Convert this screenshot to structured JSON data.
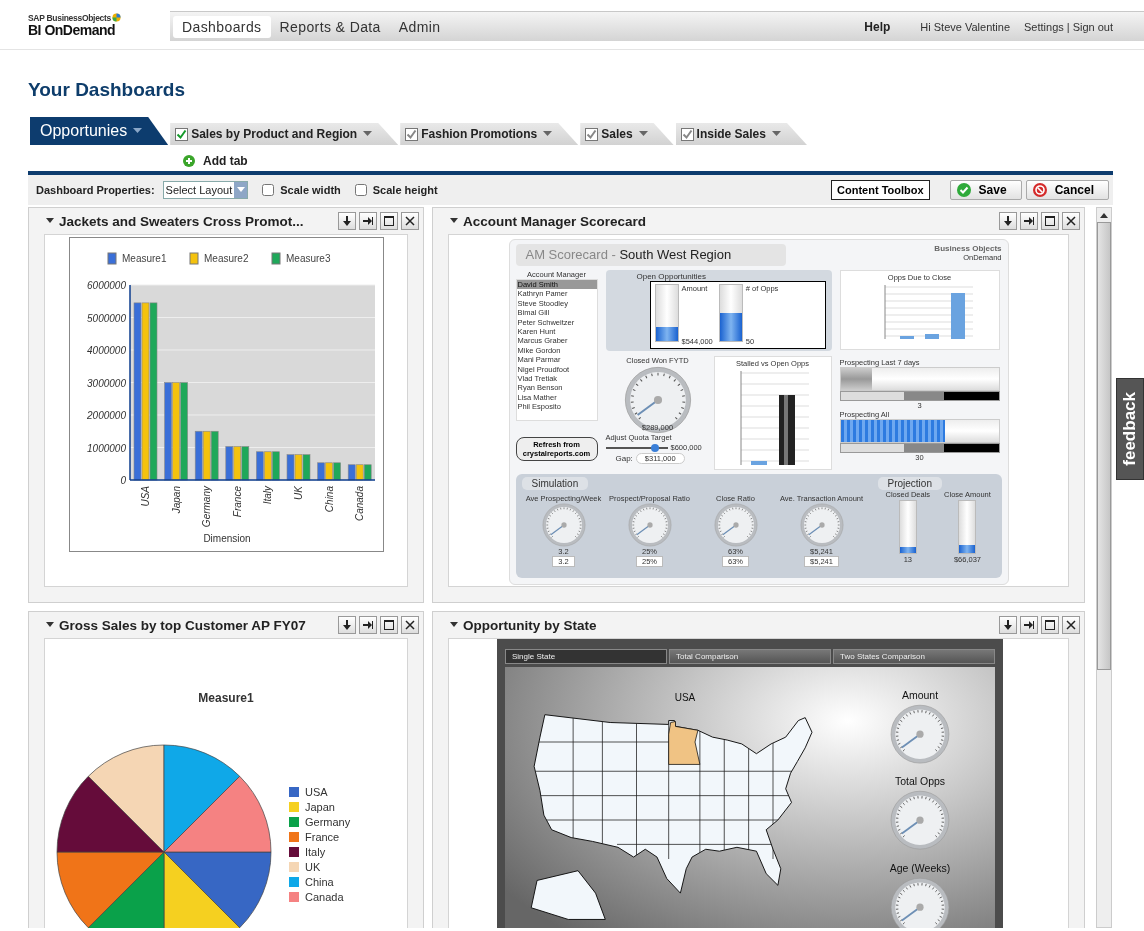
{
  "header": {
    "logo_top": "SAP BusinessObjects",
    "logo_bottom": "BI OnDemand",
    "nav": [
      {
        "label": "Dashboards",
        "selected": true
      },
      {
        "label": "Reports & Data",
        "selected": false
      },
      {
        "label": "Admin",
        "selected": false
      }
    ],
    "help": "Help",
    "greeting": "Hi Steve Valentine",
    "links": [
      "Settings",
      "Sign out"
    ],
    "separator": "|"
  },
  "page_title": "Your Dashboards",
  "tabs": [
    {
      "label": "Opportunies",
      "selected": true
    },
    {
      "label": "Sales by Product and Region",
      "selected": false,
      "checked": true,
      "checkbox_disabled": false
    },
    {
      "label": "Fashion Promotions",
      "selected": false,
      "checked": true,
      "checkbox_disabled": true
    },
    {
      "label": "Sales",
      "selected": false,
      "checked": true,
      "checkbox_disabled": true
    },
    {
      "label": "Inside Sales",
      "selected": false,
      "checked": true,
      "checkbox_disabled": true
    }
  ],
  "add_tab": "Add tab",
  "toolbar": {
    "label": "Dashboard Properties:",
    "layout_select": "Select Layout",
    "options": [
      {
        "label": "Scale width",
        "checked": false
      },
      {
        "label": "Scale height",
        "checked": false
      }
    ],
    "content_toolbox": "Content Toolbox",
    "save": "Save",
    "cancel": "Cancel"
  },
  "panels": [
    {
      "kind": "bar_chart",
      "title": "Jackets and Sweaters Cross Promot...",
      "chart_data": {
        "type": "bar",
        "xlabel": "Dimension",
        "categories": [
          "USA",
          "Japan",
          "Germany",
          "France",
          "Italy",
          "UK",
          "China",
          "Canada"
        ],
        "series": [
          {
            "name": "Measure1",
            "color": "#3a6fd8",
            "values": [
              5450000,
              3000000,
              1500000,
              1030000,
              870000,
              780000,
              530000,
              470000
            ]
          },
          {
            "name": "Measure2",
            "color": "#f4c20d",
            "values": [
              5450000,
              3000000,
              1500000,
              1030000,
              870000,
              780000,
              530000,
              470000
            ]
          },
          {
            "name": "Measure3",
            "color": "#1fa85a",
            "values": [
              5450000,
              3000000,
              1500000,
              1030000,
              870000,
              780000,
              530000,
              470000
            ]
          }
        ],
        "ylim": [
          0,
          6000000
        ],
        "yticks": [
          0,
          1000000,
          2000000,
          3000000,
          4000000,
          5000000,
          6000000
        ],
        "grid": true,
        "legend": true
      }
    },
    {
      "kind": "scorecard",
      "title": "Account Manager Scorecard",
      "scorecard": {
        "title_prefix": "AM Scorecard -",
        "title": "South West Region",
        "logo_name": "Business Objects",
        "logo_sub": "OnDemand",
        "account_heading": "Account Manager",
        "accounts": [
          {
            "name": "David Smith",
            "selected": true
          },
          {
            "name": "Kathryn Pamer",
            "selected": false
          },
          {
            "name": "Steve Stoodley",
            "selected": false
          },
          {
            "name": "Bimal Gill",
            "selected": false
          },
          {
            "name": "Peter Schweitzer",
            "selected": false
          },
          {
            "name": "Karen Hunt",
            "selected": false
          },
          {
            "name": "Marcus Graber",
            "selected": false
          },
          {
            "name": "Mike Gordon",
            "selected": false
          },
          {
            "name": "Mani Parmar",
            "selected": false
          },
          {
            "name": "Nigel Proudfoot",
            "selected": false
          },
          {
            "name": "Vlad Tretiak",
            "selected": false
          },
          {
            "name": "Ryan Benson",
            "selected": false
          },
          {
            "name": "Lisa Mather",
            "selected": false
          },
          {
            "name": "Phil Esposito",
            "selected": false
          }
        ],
        "refresh_button": "Refresh from crystalreports.com",
        "open_opportunities": {
          "title": "Open Opportunities",
          "meters": [
            {
              "label": "Amount",
              "reading": "$544,000",
              "level": 0.25
            },
            {
              "label": "# of Opps",
              "reading": "50",
              "level": 0.5
            }
          ]
        },
        "closed_won": {
          "title": "Closed Won FYTD",
          "reading": "$289,000"
        },
        "quota": {
          "label": "Adjust Quota Target",
          "reading": "$600,000",
          "level": 0.8,
          "gap_label": "Gap:",
          "gap_value": "$311,000"
        },
        "stalled_title": "Stalled vs Open Opps",
        "opps_due_title": "Opps Due to Close",
        "prospecting": [
          {
            "title": "Prospecting Last 7 days",
            "reading": "3",
            "level": 0.2
          },
          {
            "title": "Prospecting All",
            "reading": "30",
            "level": 0.66
          }
        ],
        "simulation": {
          "title": "Simulation",
          "gauges": [
            {
              "label": "Ave Prospecting/Week",
              "reading": "3.2",
              "value": "3.2"
            },
            {
              "label": "Prospect/Proposal Ratio",
              "reading": "25%",
              "value": "25%"
            },
            {
              "label": "Close Ratio",
              "reading": "63%",
              "value": "63%"
            },
            {
              "label": "Ave. Transaction Amount",
              "reading": "$5,241",
              "value": "$5,241"
            }
          ]
        },
        "projection": {
          "title": "Projection",
          "meters": [
            {
              "label": "Closed Deals",
              "reading": "13",
              "level": 0.12
            },
            {
              "label": "Close Amount",
              "reading": "$66,037",
              "level": 0.15
            }
          ]
        }
      }
    },
    {
      "kind": "pie",
      "title": "Gross Sales by top Customer AP FY07",
      "pie_title": "Measure1",
      "legend": [
        {
          "label": "USA",
          "color": "#3767c4"
        },
        {
          "label": "Japan",
          "color": "#f5d020"
        },
        {
          "label": "Germany",
          "color": "#0aa14a"
        },
        {
          "label": "France",
          "color": "#f07418"
        },
        {
          "label": "Italy",
          "color": "#650c3a"
        },
        {
          "label": "UK",
          "color": "#f5d6b4"
        },
        {
          "label": "China",
          "color": "#0fa8e8"
        },
        {
          "label": "Canada",
          "color": "#f58282"
        }
      ]
    },
    {
      "kind": "map",
      "title": "Opportunity by State",
      "tabs": [
        {
          "label": "Single State",
          "selected": true
        },
        {
          "label": "Total Comparison",
          "selected": false
        },
        {
          "label": "Two States Comparison",
          "selected": false
        }
      ],
      "map_title": "USA",
      "gauges": [
        "Amount",
        "Total Opps",
        "Age (Weeks)"
      ]
    }
  ],
  "feedback": "feedback"
}
